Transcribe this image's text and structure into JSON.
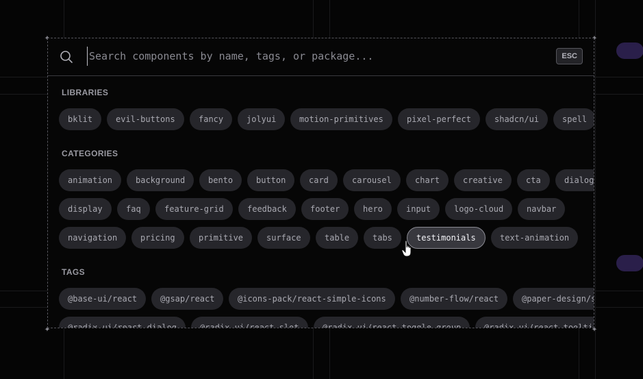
{
  "search": {
    "placeholder": "Search components by name, tags, or package...",
    "value": "",
    "esc_label": "ESC"
  },
  "sections": {
    "libraries": {
      "title": "LIBRARIES",
      "items": [
        "bklit",
        "evil-buttons",
        "fancy",
        "jolyui",
        "motion-primitives",
        "pixel-perfect",
        "shadcn/ui",
        "spell"
      ]
    },
    "categories": {
      "title": "CATEGORIES",
      "rows": [
        [
          "animation",
          "background",
          "bento",
          "button",
          "card",
          "carousel",
          "chart",
          "creative",
          "cta",
          "dialog"
        ],
        [
          "display",
          "faq",
          "feature-grid",
          "feedback",
          "footer",
          "hero",
          "input",
          "logo-cloud",
          "navbar"
        ],
        [
          "navigation",
          "pricing",
          "primitive",
          "surface",
          "table",
          "tabs",
          "testimonials",
          "text-animation"
        ]
      ],
      "active": "testimonials"
    },
    "tags": {
      "title": "TAGS",
      "rows": [
        [
          "@base-ui/react",
          "@gsap/react",
          "@icons-pack/react-simple-icons",
          "@number-flow/react",
          "@paper-design/shaders"
        ],
        [
          "@radix-ui/react-dialog",
          "@radix-ui/react-slot",
          "@radix-ui/react-toggle-group",
          "@radix-ui/react-tooltip"
        ]
      ]
    }
  },
  "colors": {
    "background": "#050505",
    "chip": "#26262b",
    "chip_active": "#38383e",
    "border": "#55555c"
  }
}
